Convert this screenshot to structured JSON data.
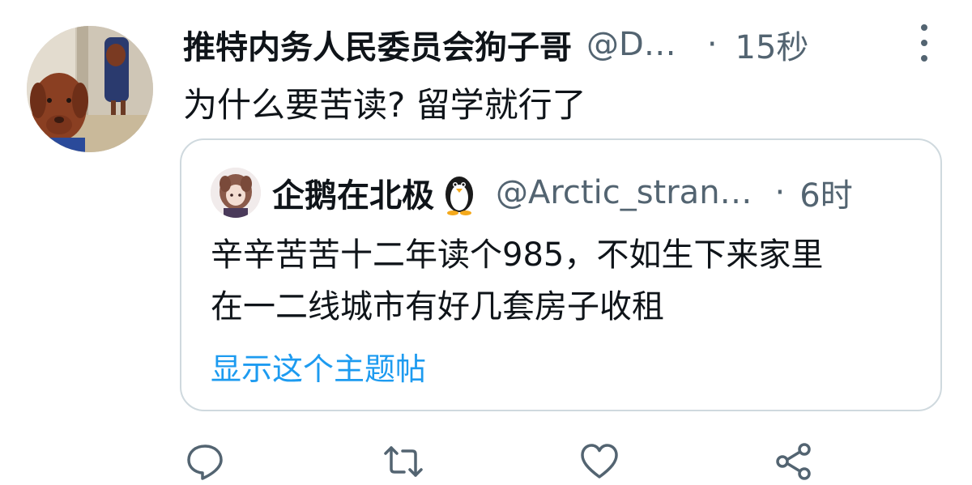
{
  "tweet": {
    "display_name": "推特内务人民委员会狗子哥",
    "handle": "@D…",
    "separator": "·",
    "time": "15秒",
    "text": "为什么要苦读? 留学就行了"
  },
  "quoted_tweet": {
    "display_name": "企鹅在北极",
    "handle": "@Arctic_stran…",
    "separator": "·",
    "time": "6时",
    "text_line1": "辛辛苦苦十二年读个985，不如生下来家里",
    "text_line2": "在一二线城市有好几套房子收租",
    "show_thread": "显示这个主题帖"
  },
  "actions": {
    "icons": [
      "reply-icon",
      "retweet-icon",
      "like-icon",
      "share-icon"
    ]
  },
  "colors": {
    "text": "#0f1419",
    "secondary": "#536471",
    "link": "#1d9bf0",
    "border": "#cfd9de"
  }
}
